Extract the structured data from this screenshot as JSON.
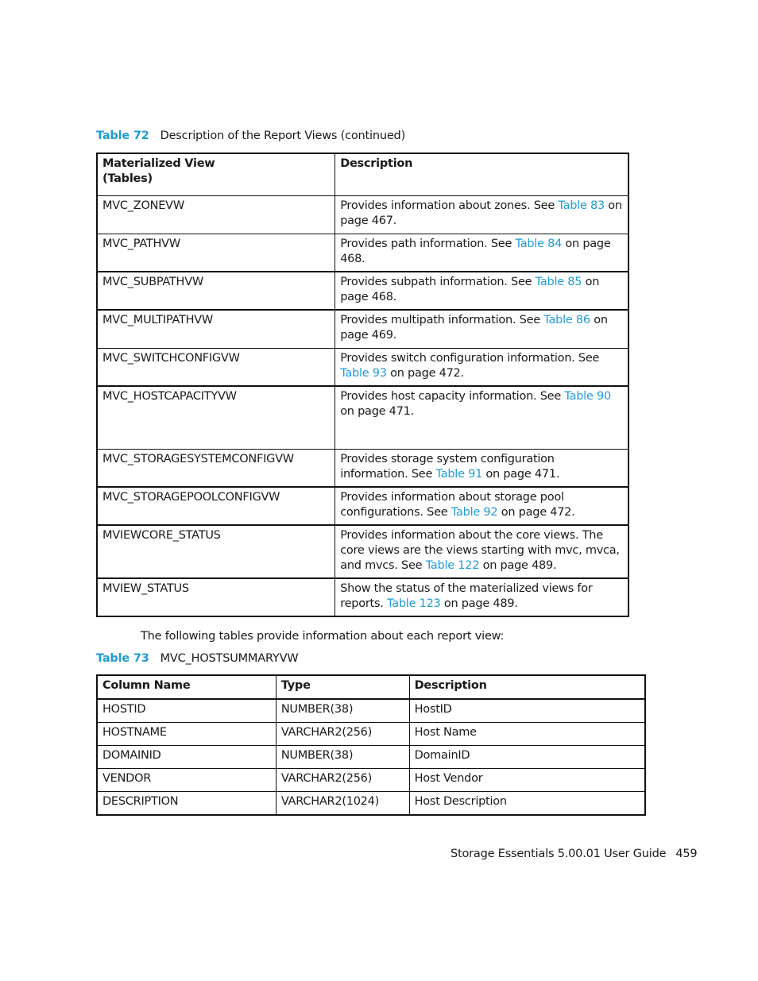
{
  "table72": {
    "caption_number": "Table 72",
    "caption_text": "Description of the Report Views (continued)",
    "headers": [
      "Materialized View",
      "(Tables)",
      "Description"
    ],
    "rows": [
      {
        "name": "MVC_ZONEVW",
        "pre": "Provides information about zones. See ",
        "link": "Table 83",
        "post": " on page 467.",
        "h": 48,
        "b": 1
      },
      {
        "name": "MVC_PATHVW",
        "pre": "Provides path information. See ",
        "link": "Table 84",
        "post": " on page 468.",
        "h": 48,
        "b": 2
      },
      {
        "name": "MVC_SUBPATHVW",
        "pre": "Provides subpath information. See ",
        "link": "Table 85",
        "post": " on page 468.",
        "h": 48,
        "b": 2
      },
      {
        "name": "MVC_MULTIPATHVW",
        "pre": "Provides multipath information. See ",
        "link": "Table 86",
        "post": " on page 469.",
        "h": 48,
        "b": 1
      },
      {
        "name": "MVC_SWITCHCONFIGVW",
        "pre": "Provides switch configuration information. See ",
        "link": "Table 93",
        "post": " on page 472.",
        "h": 48,
        "b": 2
      },
      {
        "name": "MVC_HOSTCAPACITYVW",
        "pre": "Provides host capacity information. See ",
        "link": "Table 90",
        "post": " on page 471.",
        "h": 79,
        "b": 1
      },
      {
        "name": "MVC_STORAGESYSTEMCONFIGVW",
        "pre": "Provides storage system configuration information. See ",
        "link": "Table 91",
        "post": " on page 471.",
        "h": 48,
        "b": 2
      },
      {
        "name": "MVC_STORAGEPOOLCONFIGVW",
        "pre": "Provides information about storage pool configurations. See ",
        "link": "Table 92",
        "post": " on page 472.",
        "h": 48,
        "b": 2
      },
      {
        "name": "MVIEWCORE_STATUS",
        "pre": "Provides information about the core views. The core views are the views starting with mvc, mvca, and mvcs. See ",
        "link": "Table 122",
        "post": " on page 489.",
        "h": 67,
        "b": 2
      },
      {
        "name": "MVIEW_STATUS",
        "pre": "Show the status of the materialized views for reports. ",
        "link": "Table 123",
        "post": " on page 489.",
        "h": 48,
        "b": 0
      }
    ]
  },
  "intro_text": "The following tables provide information about each report view:",
  "table73": {
    "caption_number": "Table 73",
    "caption_text": "MVC_HOSTSUMMARYVW",
    "headers": [
      "Column Name",
      "Type",
      "Description"
    ],
    "rows": [
      [
        "HOSTID",
        "NUMBER(38)",
        "HostID"
      ],
      [
        "HOSTNAME",
        "VARCHAR2(256)",
        "Host Name"
      ],
      [
        "DOMAINID",
        "NUMBER(38)",
        "DomainID"
      ],
      [
        "VENDOR",
        "VARCHAR2(256)",
        "Host Vendor"
      ],
      [
        "DESCRIPTION",
        "VARCHAR2(1024)",
        "Host Description"
      ]
    ]
  },
  "footer": {
    "title": "Storage Essentials 5.00.01 User Guide",
    "page_number": "459"
  },
  "colors": {
    "link": "#1f9bd7",
    "text": "#1a1a1a",
    "border": "#111111"
  }
}
